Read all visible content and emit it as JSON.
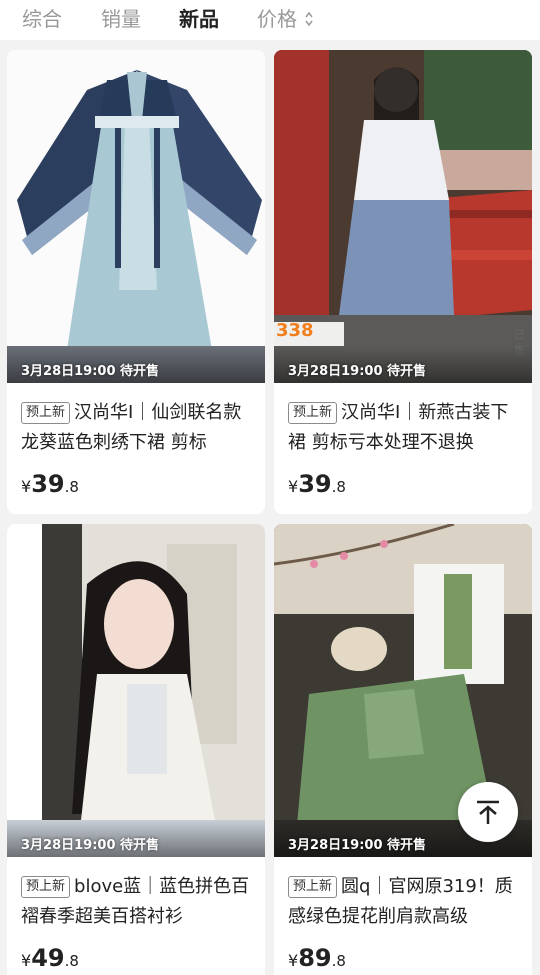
{
  "sort_bar": {
    "tabs": [
      {
        "label": "综合"
      },
      {
        "label": "销量"
      },
      {
        "label": "新品"
      },
      {
        "label": "价格"
      }
    ],
    "active_tab": "新品",
    "price_sort_icon": "sort-up-down-icon"
  },
  "products": [
    {
      "presale_text": "3月28日19:00 待开售",
      "badge": "预上新",
      "title": "汉尚华I｜仙剑联名款 龙葵蓝色刺绣下裙 剪标",
      "price_symbol": "¥",
      "price_int": "39",
      "price_dec": ".8"
    },
    {
      "presale_text": "3月28日19:00 待开售",
      "badge": "预上新",
      "title": "汉尚华I｜新燕古装下裙 剪标亏本处理不退换",
      "price_symbol": "¥",
      "price_int": "39",
      "price_dec": ".8",
      "image_tag_price": "338",
      "image_tag_right": "已售"
    },
    {
      "presale_text": "3月28日19:00 待开售",
      "badge": "预上新",
      "title": "blove蓝｜蓝色拼色百褶春季超美百搭衬衫",
      "price_symbol": "¥",
      "price_int": "49",
      "price_dec": ".8"
    },
    {
      "presale_text": "3月28日19:00 待开售",
      "badge": "预上新",
      "title": "圆q｜官网原319！质感绿色提花削肩款高级",
      "price_symbol": "¥",
      "price_int": "89",
      "price_dec": ".8"
    }
  ],
  "scroll_top_icon": "arrow-up-to-top-icon"
}
